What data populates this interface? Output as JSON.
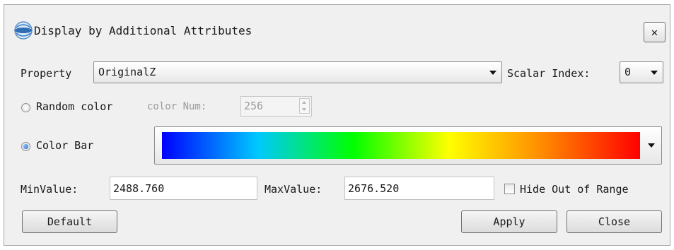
{
  "window": {
    "title": "Display by Additional Attributes",
    "close_symbol": "✕"
  },
  "property": {
    "label": "Property",
    "value": "OriginalZ"
  },
  "scalar_index": {
    "label": "Scalar Index:",
    "value": "0"
  },
  "random_color": {
    "label": "Random color",
    "checked": false,
    "num_label": "color Num:",
    "num_value": "256"
  },
  "color_bar": {
    "label": "Color Bar",
    "checked": true,
    "gradient_colors": [
      "#0000ff",
      "#00c8ff",
      "#00ff00",
      "#ffff00",
      "#ff8800",
      "#ff0000"
    ]
  },
  "range": {
    "min_label": "MinValue:",
    "min_value": "2488.760",
    "max_label": "MaxValue:",
    "max_value": "2676.520",
    "hide_label": "Hide Out of Range",
    "hide_checked": false
  },
  "buttons": {
    "default": "Default",
    "apply": "Apply",
    "close": "Close"
  },
  "colors": {
    "dialog_bg": "#f0f0f0",
    "radio_accent": "#1d5fbf"
  }
}
